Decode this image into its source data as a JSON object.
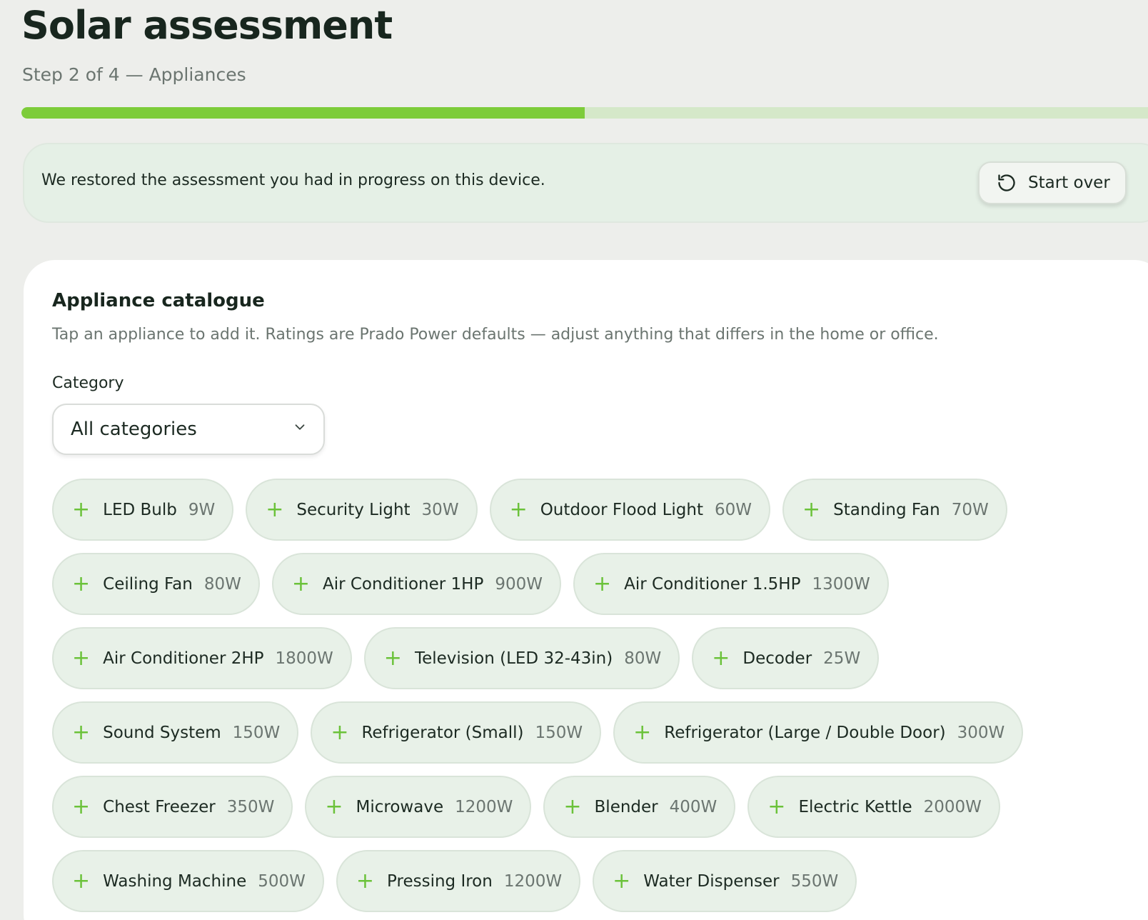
{
  "header": {
    "title": "Solar assessment",
    "step": "Step 2 of 4 — Appliances",
    "progress_fraction": 0.5
  },
  "notice": {
    "text": "We restored the assessment you had in progress on this device.",
    "start_over_label": "Start over",
    "start_over_icon": "restart-icon"
  },
  "catalogue": {
    "title": "Appliance catalogue",
    "description": "Tap an appliance to add it. Ratings are Prado Power defaults — adjust anything that differs in the home or office.",
    "category_label": "Category",
    "category_selected": "All categories",
    "add_icon": "plus-icon",
    "items": [
      {
        "name": "LED Bulb",
        "watts": "9W"
      },
      {
        "name": "Security Light",
        "watts": "30W"
      },
      {
        "name": "Outdoor Flood Light",
        "watts": "60W"
      },
      {
        "name": "Standing Fan",
        "watts": "70W"
      },
      {
        "name": "Ceiling Fan",
        "watts": "80W"
      },
      {
        "name": "Air Conditioner 1HP",
        "watts": "900W"
      },
      {
        "name": "Air Conditioner 1.5HP",
        "watts": "1300W"
      },
      {
        "name": "Air Conditioner 2HP",
        "watts": "1800W"
      },
      {
        "name": "Television (LED 32-43in)",
        "watts": "80W"
      },
      {
        "name": "Decoder",
        "watts": "25W"
      },
      {
        "name": "Sound System",
        "watts": "150W"
      },
      {
        "name": "Refrigerator (Small)",
        "watts": "150W"
      },
      {
        "name": "Refrigerator (Large / Double Door)",
        "watts": "300W"
      },
      {
        "name": "Chest Freezer",
        "watts": "350W"
      },
      {
        "name": "Microwave",
        "watts": "1200W"
      },
      {
        "name": "Blender",
        "watts": "400W"
      },
      {
        "name": "Electric Kettle",
        "watts": "2000W"
      },
      {
        "name": "Washing Machine",
        "watts": "500W"
      },
      {
        "name": "Pressing Iron",
        "watts": "1200W"
      },
      {
        "name": "Water Dispenser",
        "watts": "550W"
      }
    ]
  },
  "colors": {
    "accent": "#7dcc3a",
    "progress_track": "#d5e8c9",
    "chip_bg": "#e8f1e8",
    "notice_bg": "#e5f0e6",
    "page_bg": "#edeeeb"
  }
}
